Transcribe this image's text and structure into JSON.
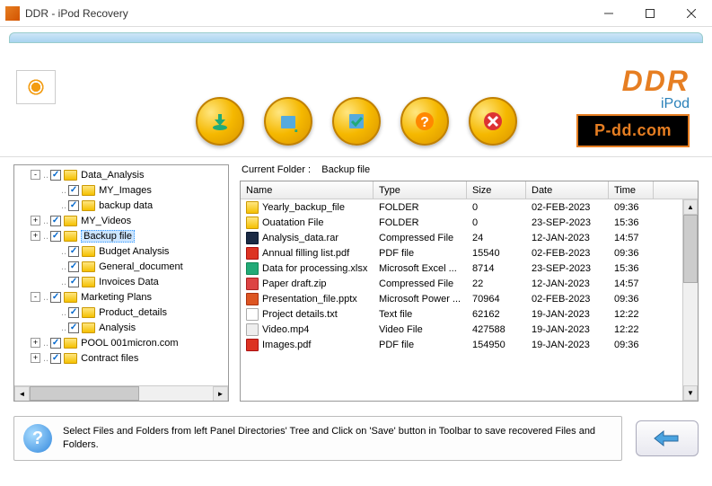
{
  "window": {
    "title": "DDR - iPod Recovery"
  },
  "brand": {
    "main": "DDR",
    "sub": "iPod",
    "badge": "P-dd.com"
  },
  "tree": [
    {
      "indent": 0,
      "expand": "-",
      "checked": true,
      "label": "Data_Analysis"
    },
    {
      "indent": 1,
      "expand": "",
      "checked": true,
      "label": "MY_Images"
    },
    {
      "indent": 1,
      "expand": "",
      "checked": true,
      "label": "backup data"
    },
    {
      "indent": 0,
      "expand": "+",
      "checked": true,
      "label": "MY_Videos"
    },
    {
      "indent": 0,
      "expand": "+",
      "checked": true,
      "label": "Backup file",
      "selected": true
    },
    {
      "indent": 1,
      "expand": "",
      "checked": true,
      "label": "Budget Analysis"
    },
    {
      "indent": 1,
      "expand": "",
      "checked": true,
      "label": "General_document"
    },
    {
      "indent": 1,
      "expand": "",
      "checked": true,
      "label": "Invoices Data"
    },
    {
      "indent": 0,
      "expand": "-",
      "checked": true,
      "label": "Marketing Plans"
    },
    {
      "indent": 1,
      "expand": "",
      "checked": true,
      "label": "Product_details"
    },
    {
      "indent": 1,
      "expand": "",
      "checked": true,
      "label": "Analysis"
    },
    {
      "indent": 0,
      "expand": "+",
      "checked": true,
      "label": "POOL 001micron.com"
    },
    {
      "indent": 0,
      "expand": "+",
      "checked": true,
      "label": "Contract files"
    }
  ],
  "currentFolder": {
    "label": "Current Folder  :",
    "value": "Backup file"
  },
  "columns": {
    "name": "Name",
    "type": "Type",
    "size": "Size",
    "date": "Date",
    "time": "Time"
  },
  "files": [
    {
      "icon": "folder",
      "name": "Yearly_backup_file",
      "type": "FOLDER",
      "size": "0",
      "date": "02-FEB-2023",
      "time": "09:36"
    },
    {
      "icon": "folder",
      "name": "Ouatation File",
      "type": "FOLDER",
      "size": "0",
      "date": "23-SEP-2023",
      "time": "15:36"
    },
    {
      "icon": "rar",
      "name": "Analysis_data.rar",
      "type": "Compressed File",
      "size": "24",
      "date": "12-JAN-2023",
      "time": "14:57"
    },
    {
      "icon": "pdf",
      "name": "Annual filling list.pdf",
      "type": "PDF file",
      "size": "15540",
      "date": "02-FEB-2023",
      "time": "09:36"
    },
    {
      "icon": "xls",
      "name": "Data for processing.xlsx",
      "type": "Microsoft Excel ...",
      "size": "8714",
      "date": "23-SEP-2023",
      "time": "15:36"
    },
    {
      "icon": "zip",
      "name": "Paper draft.zip",
      "type": "Compressed File",
      "size": "22",
      "date": "12-JAN-2023",
      "time": "14:57"
    },
    {
      "icon": "ppt",
      "name": "Presentation_file.pptx",
      "type": "Microsoft Power ...",
      "size": "70964",
      "date": "02-FEB-2023",
      "time": "09:36"
    },
    {
      "icon": "txt",
      "name": "Project details.txt",
      "type": "Text file",
      "size": "62162",
      "date": "19-JAN-2023",
      "time": "12:22"
    },
    {
      "icon": "vid",
      "name": "Video.mp4",
      "type": "Video File",
      "size": "427588",
      "date": "19-JAN-2023",
      "time": "12:22"
    },
    {
      "icon": "pdf",
      "name": "Images.pdf",
      "type": "PDF file",
      "size": "154950",
      "date": "19-JAN-2023",
      "time": "09:36"
    }
  ],
  "hint": "Select Files and Folders from left Panel Directories' Tree and Click on 'Save' button in Toolbar to save recovered Files and Folders."
}
